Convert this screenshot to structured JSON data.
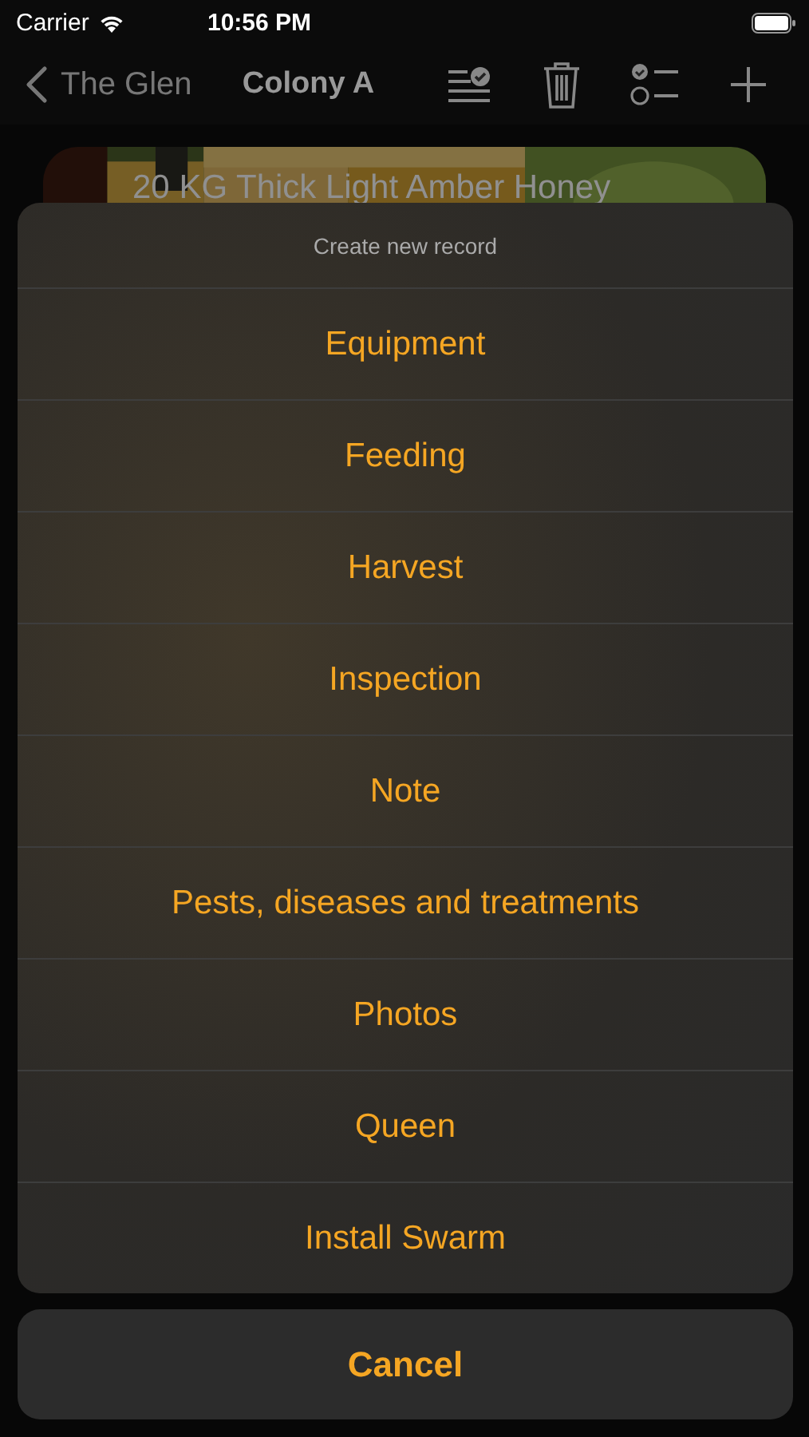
{
  "status_bar": {
    "carrier": "Carrier",
    "time": "10:56 PM"
  },
  "nav_bar": {
    "back": "The Glen",
    "title": "Colony A"
  },
  "record_card": {
    "kind": "picture",
    "title": "20 KG Thick Light Amber Honey"
  },
  "action_sheet": {
    "title": "Create new record",
    "actions": [
      "Equipment",
      "Feeding",
      "Harvest",
      "Inspection",
      "Note",
      "Pests, diseases and treatments",
      "Photos",
      "Queen",
      "Install Swarm"
    ],
    "cancel": "Cancel"
  }
}
